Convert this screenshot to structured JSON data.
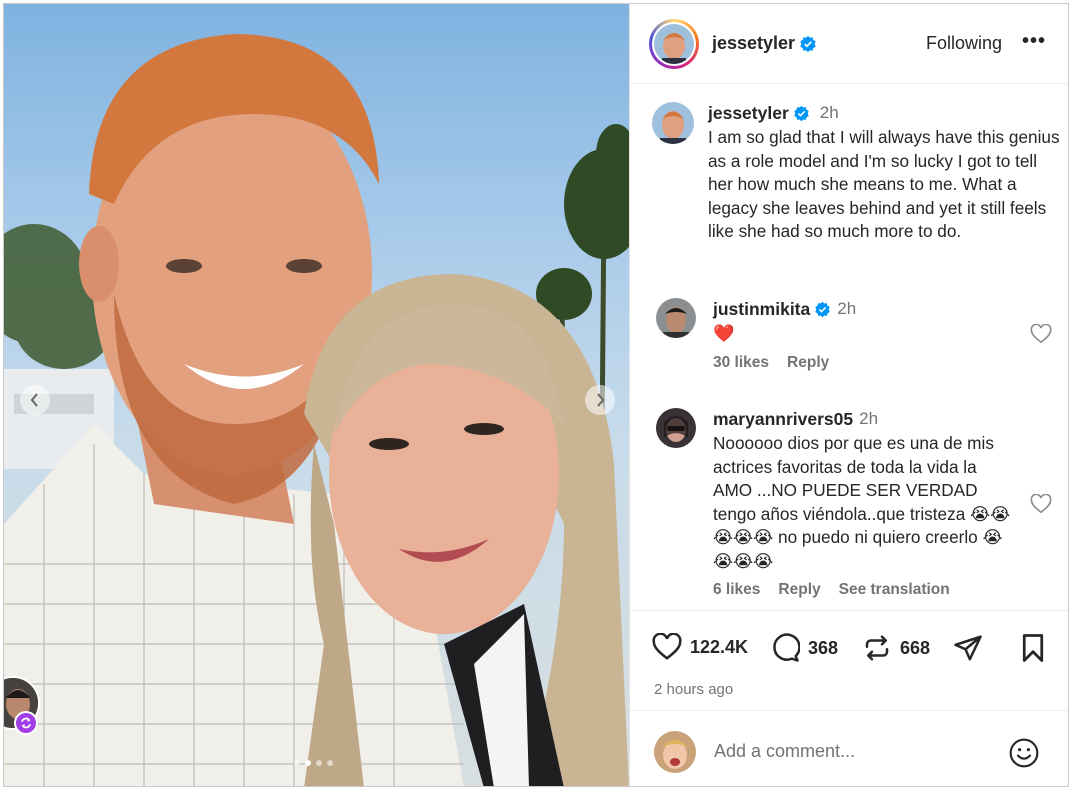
{
  "post": {
    "author": "jessetyler",
    "follow_label": "Following",
    "more_label": "•••",
    "caption": {
      "username": "jessetyler",
      "time": "2h",
      "text": "I am so glad that I will always have this genius as a role model and I'm so lucky I got to tell her how much she means to me. What a legacy she leaves behind and yet it still feels like she had so much more to do."
    },
    "comments": [
      {
        "username": "justinmikita",
        "verified": true,
        "time": "2h",
        "text": "❤️",
        "likes": "30 likes",
        "reply": "Reply"
      },
      {
        "username": "maryannrivers05",
        "verified": false,
        "time": "2h",
        "text": "Noooooo dios por que es una de mis actrices favoritas de toda la vida la AMO ...NO PUEDE SER VERDAD tengo años viéndola..que tristeza 😭😭😭😭😭 no puedo ni quiero creerlo 😭😭😭😭",
        "likes": "6 likes",
        "reply": "Reply",
        "translate": "See translation"
      }
    ],
    "stats": {
      "likes": "122.4K",
      "comments": "368",
      "reposts": "668"
    },
    "posted_ago": "2 hours ago",
    "add_comment_placeholder": "Add a comment...",
    "carousel": {
      "total": 4,
      "active": 1
    }
  },
  "icons": {
    "verified": "verified-badge-icon",
    "like": "heart-icon",
    "comment": "speech-bubble-icon",
    "repost": "repost-icon",
    "share": "paper-plane-icon",
    "save": "bookmark-icon",
    "emoji": "smiley-icon"
  },
  "colors": {
    "verified": "#0095f6",
    "heart_red": "#ed1c24",
    "muted_text": "#737373",
    "text": "#262626",
    "collab_badge": "#a23ee8"
  }
}
